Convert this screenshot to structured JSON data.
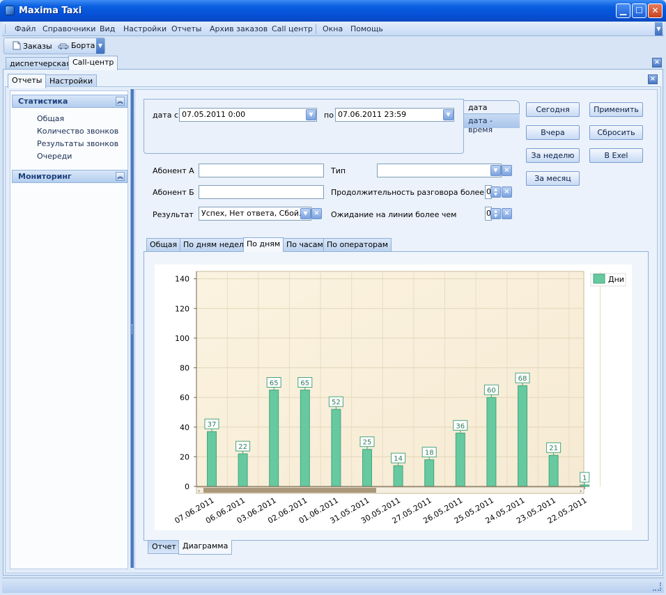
{
  "window": {
    "title": "Maxima Taxi",
    "min_glyph": "▁",
    "max_glyph": "☐",
    "close_glyph": "✕"
  },
  "menu": [
    "Файл",
    "Справочники",
    "Вид",
    "Настройки",
    "Отчеты",
    "Архив заказов",
    "Call центр",
    "Окна",
    "Помощь"
  ],
  "toolbar": {
    "orders_label": "Заказы",
    "cars_label": "Борта"
  },
  "main_tabs": [
    "диспетчерская",
    "Call-центр"
  ],
  "sub_tabs": [
    "Отчеты",
    "Настройки"
  ],
  "nav": {
    "statistics_title": "Статистика",
    "statistics_items": [
      "Общая",
      "Количество звонков",
      "Результаты звонков",
      "Очереди"
    ],
    "monitoring_title": "Мониторинг"
  },
  "filters": {
    "date_from_label": "дата с",
    "date_from_value": "07.05.2011 0:00",
    "date_to_label": "по",
    "date_to_value": "07.06.2011 23:59",
    "mode_tab_date": "дата",
    "mode_tab_datetime": "дата - время",
    "subscriber_a_label": "Абонент А",
    "subscriber_b_label": "Абонент Б",
    "result_label": "Результат",
    "result_value": "Успех, Нет ответа, Сбой...",
    "type_label": "Тип",
    "duration_label": "Продолжительность разговора более чем",
    "duration_value": "0",
    "waiting_label": "Ожидание на линии более чем",
    "waiting_value": "0"
  },
  "buttons": {
    "today": "Сегодня",
    "yesterday": "Вчера",
    "week": "За неделю",
    "month": "За месяц",
    "apply": "Применить",
    "reset": "Сбросить",
    "excel": "В Exel"
  },
  "chart_tabs": [
    "Общая",
    "По дням недели",
    "По дням",
    "По часам",
    "По операторам"
  ],
  "view_tabs": [
    "Отчет",
    "Диаграмма"
  ],
  "chart_data": {
    "type": "bar",
    "title": "",
    "xlabel": "",
    "ylabel": "",
    "categories": [
      "07.06.2011",
      "06.06.2011",
      "03.06.2011",
      "02.06.2011",
      "01.06.2011",
      "31.05.2011",
      "30.05.2011",
      "27.05.2011",
      "26.05.2011",
      "25.05.2011",
      "24.05.2011",
      "23.05.2011",
      "22.05.2011"
    ],
    "series": [
      {
        "name": "Дни",
        "color": "#66c9a0",
        "values": [
          37,
          22,
          65,
          65,
          52,
          25,
          14,
          18,
          36,
          60,
          68,
          21,
          1
        ]
      }
    ],
    "ylim": [
      0,
      145
    ],
    "yticks": [
      0,
      20,
      40,
      60,
      80,
      100,
      120,
      140
    ],
    "grid": true,
    "legend_position": "top-right",
    "data_labels": true,
    "last_label_text": "1"
  }
}
